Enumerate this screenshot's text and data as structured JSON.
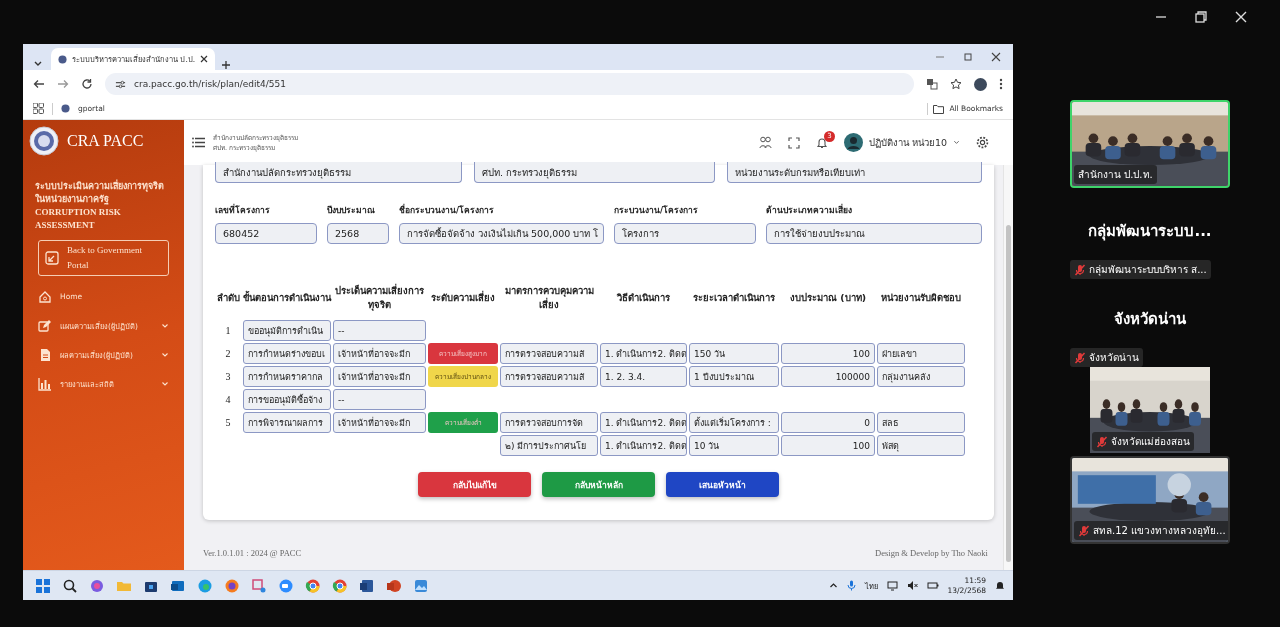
{
  "browser": {
    "tab_title": "ระบบบริหารความเสี่ยงสำนักงาน ป.ป.",
    "address": "cra.pacc.go.th/risk/plan/edit4/551",
    "bookmarks": [
      "gportal"
    ],
    "all_bookmarks": "All Bookmarks"
  },
  "sidebar": {
    "brand": "CRA PACC",
    "system_title": "ระบบประเมินความเสี่ยงการทุจริตในหน่วยงานภาครัฐ CORRUPTION RISK ASSESSMENT",
    "portal_button": "Back to Government Portal",
    "menu": [
      {
        "label": "Home",
        "expandable": false
      },
      {
        "label": "แผนความเสี่ยง(ผู้ปฏิบัติ)",
        "expandable": true
      },
      {
        "label": "ผลความเสี่ยง(ผู้ปฏิบัติ)",
        "expandable": true
      },
      {
        "label": "รายงานและสถิติ",
        "expandable": true
      }
    ]
  },
  "header": {
    "org_lines": [
      "สำนักงานปลัดกระทรวงยุติธรรม",
      "ศปท. กระทรวงยุติธรรม"
    ],
    "notification_count": "3",
    "user": "ปฏิบัติงาน หน่วย10"
  },
  "form": {
    "top_fields": [
      "สำนักงานปลัดกระทรวงยุติธรรม",
      "ศปท. กระทรวงยุติธรรม",
      "หน่วยงานระดับกรมหรือเทียบเท่า"
    ],
    "fields": [
      {
        "label": "เลขที่โครงการ",
        "value": "680452"
      },
      {
        "label": "ปีงบประมาณ",
        "value": "2568"
      },
      {
        "label": "ชื่อกระบวนงาน/โครงการ",
        "value": "การจัดซื้อจัดจ้าง วงเงินไม่เกิน 500,000 บาท โ"
      },
      {
        "label": "กระบวนงาน/โครงการ",
        "value": "โครงการ"
      },
      {
        "label": "ด้านประเภทความเสี่ยง",
        "value": "การใช้จ่ายงบประมาณ"
      }
    ]
  },
  "table": {
    "columns": [
      "ลำดับ",
      "ขั้นตอนการดำเนินงาน",
      "ประเด็นความเสี่ยงการทุจริต",
      "ระดับความเสี่ยง",
      "มาตรการควบคุมความเสี่ยง",
      "วิธีดำเนินการ",
      "ระยะเวลาดำเนินการ",
      "งบประมาณ (บาท)",
      "หน่วยงานรับผิดชอบ"
    ],
    "rows": [
      {
        "index": "1",
        "step": "ขออนุมัติการดำเนิน",
        "issue": "--"
      },
      {
        "index": "2",
        "step": "การกำหนดร่างขอบเ",
        "issue": "เจ้าหน้าที่อาจจะมีก",
        "risk": {
          "label": "ความเสี่ยงสูงมาก",
          "color": "#d9363e"
        },
        "measure": "การตรวจสอบความสั",
        "method": "1. ดำเนินการ2. ติดต",
        "duration": "150 วัน",
        "budget": "100",
        "unit": "ฝ่ายเลขา"
      },
      {
        "index": "3",
        "step": "การกำหนดราคากล",
        "issue": "เจ้าหน้าที่อาจจะมีก",
        "risk": {
          "label": "ความเสี่ยงปานกลาง",
          "color": "#f0d64a"
        },
        "measure": "การตรวจสอบความสั",
        "method": "1. 2. 3.4.",
        "duration": "1 ปีงบประมาณ",
        "budget": "100000",
        "unit": "กลุ่มงานคลัง"
      },
      {
        "index": "4",
        "step": "การขออนุมัติซื้อจ้าง",
        "issue": "--"
      },
      {
        "index": "5",
        "step": "การพิจารณาผลการ",
        "issue": "เจ้าหน้าที่อาจจะมีก",
        "risk": {
          "label": "ความเสี่ยงต่ำ",
          "color": "#1fa04a"
        },
        "measure": "การตรวจสอบการจัด",
        "method": "1. ดำเนินการ2. ติดต",
        "duration": "ตั้งแต่เริ่มโครงการ :",
        "budget": "0",
        "unit": "สลธ"
      },
      {
        "measure": "๒) มีการประกาศนโย",
        "method": "1. ดำเนินการ2. ติดต",
        "duration": "10 วัน",
        "budget": "100",
        "unit": "พัสดุ"
      }
    ]
  },
  "actions": [
    {
      "label": "กลับไปแก้ไข",
      "kind": "danger"
    },
    {
      "label": "กลับหน้าหลัก",
      "kind": "success"
    },
    {
      "label": "เสนอหัวหน้า",
      "kind": "primary"
    }
  ],
  "footer": {
    "version": "Ver.1.0.1.01 : 2024 @ PACC",
    "credit": "Design & Develop by Tho Naoki"
  },
  "taskbar": {
    "language": "ไทย",
    "time": "11:59",
    "date": "13/2/2568"
  },
  "participants": [
    {
      "kind": "video",
      "name": "สำนักงาน ป.ป.ท.",
      "speaking": true,
      "muted": false
    },
    {
      "kind": "name",
      "display": "กลุ่มพัฒนาระบบ...",
      "name": "กลุ่มพัฒนาระบบบริหาร ส...",
      "speaking": false,
      "muted": true
    },
    {
      "kind": "name",
      "display": "จังหวัดน่าน",
      "name": "จังหวัดน่าน",
      "speaking": false,
      "muted": true
    },
    {
      "kind": "video",
      "name": "จังหวัดแม่ฮ่องสอน",
      "speaking": false,
      "muted": true
    },
    {
      "kind": "video",
      "name": "สทล.12 แขวงทางหลวงอุทัย...",
      "speaking": false,
      "muted": true
    }
  ]
}
